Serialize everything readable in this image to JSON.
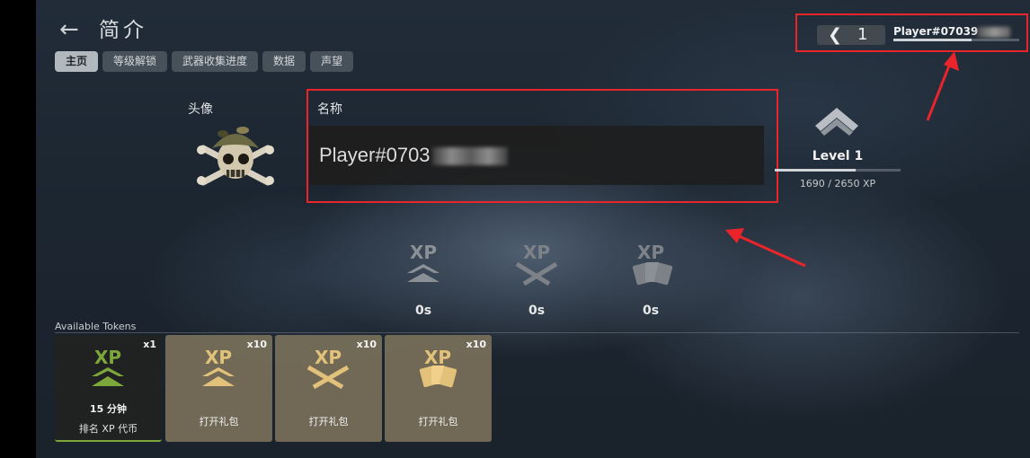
{
  "header": {
    "back_glyph": "←",
    "title": "简介"
  },
  "tabs": [
    {
      "label": "主页",
      "active": true
    },
    {
      "label": "等级解锁",
      "active": false
    },
    {
      "label": "武器收集进度",
      "active": false
    },
    {
      "label": "数据",
      "active": false
    },
    {
      "label": "声望",
      "active": false
    }
  ],
  "profile": {
    "avatar_label": "头像",
    "name_label": "名称",
    "name_value": "Player#0703",
    "name_is_partially_obscured": true
  },
  "rank": {
    "level_label": "Level 1",
    "xp_text": "1690 / 2650 XP",
    "progress": 0.64
  },
  "player_card": {
    "back_glyph": "❮",
    "number": "1",
    "tag": "Player#07039",
    "progress": 0.62
  },
  "boosts": [
    {
      "icon": "xp-rank-boost-icon",
      "time": "0s"
    },
    {
      "icon": "xp-weapon-boost-icon",
      "time": "0s"
    },
    {
      "icon": "xp-card-boost-icon",
      "time": "0s"
    }
  ],
  "tokens": {
    "section_label": "Available Tokens",
    "items": [
      {
        "icon": "xp-rank-token-icon",
        "count": "x1",
        "line1": "15 分钟",
        "line2": "排名 XP 代币",
        "selected": true
      },
      {
        "icon": "xp-rank-token-icon",
        "count": "x10",
        "label": "打开礼包"
      },
      {
        "icon": "xp-weapon-token-icon",
        "count": "x10",
        "label": "打开礼包"
      },
      {
        "icon": "xp-card-token-icon",
        "count": "x10",
        "label": "打开礼包"
      }
    ]
  },
  "colors": {
    "highlight": "#e9242a",
    "accent_green": "#7da63b",
    "gift_gold": "#c8a45d"
  }
}
